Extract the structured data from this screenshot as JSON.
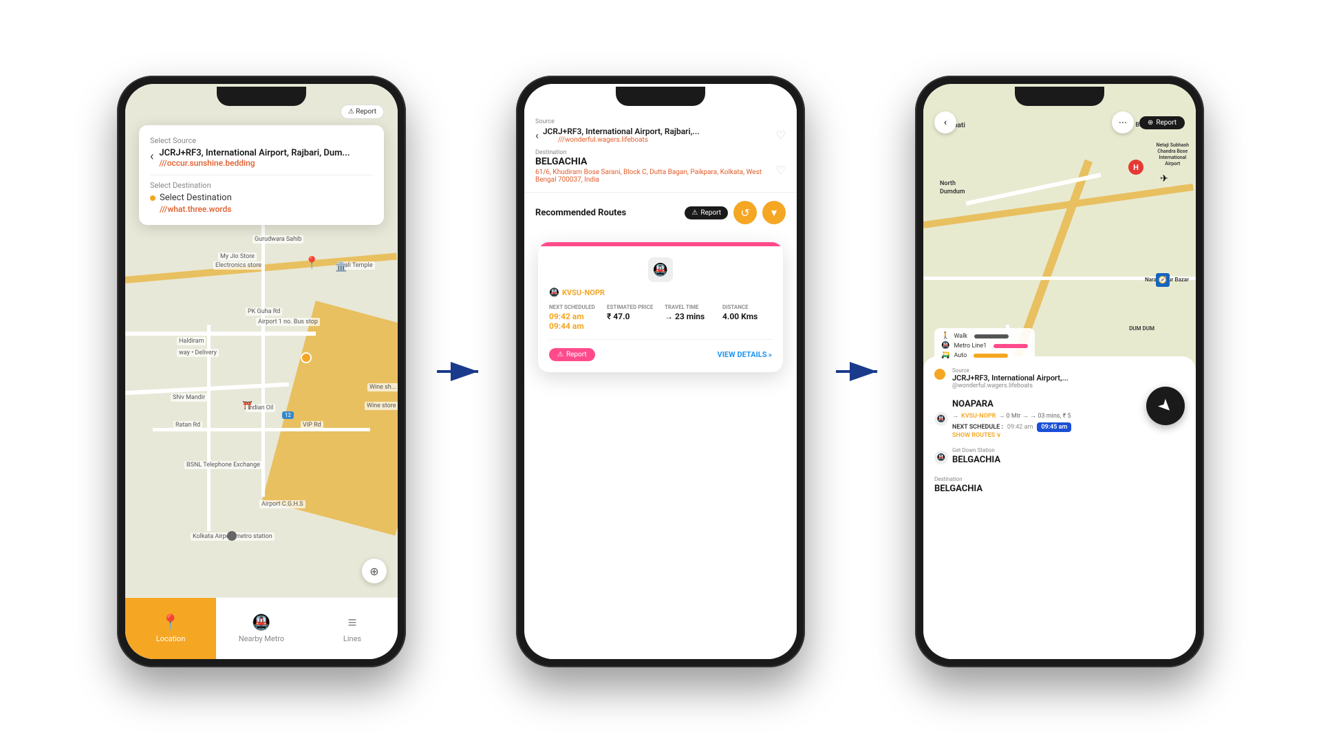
{
  "scene": {
    "arrows": [
      "→",
      "→"
    ]
  },
  "phone1": {
    "search_card": {
      "label_source": "Select Source",
      "source_name": "JCRJ+RF3, International Airport, Rajbari, Dum...",
      "source_w3w": "///occur.sunshine.bedding",
      "label_dest": "Select Destination",
      "dest_name": "Select Destination",
      "dest_w3w": "///what.three.words"
    },
    "report_btn": "Report",
    "map_labels": [
      {
        "text": "Gurudwara Sahib",
        "top": "220",
        "left": "200"
      },
      {
        "text": "My Jio Store",
        "top": "258",
        "left": "152"
      },
      {
        "text": "Electronics store",
        "top": "272",
        "left": "145"
      },
      {
        "text": "Kali Temple",
        "top": "268",
        "left": "340"
      },
      {
        "text": "Airport 1 no. Bus stop",
        "top": "348",
        "left": "210"
      },
      {
        "text": "Haldiram",
        "top": "370",
        "left": "90"
      },
      {
        "text": "way • Delivery",
        "top": "396",
        "left": "90"
      },
      {
        "text": "PK Guha Rd",
        "top": "330",
        "left": "195"
      },
      {
        "text": "Shiv Mandir",
        "top": "456",
        "left": "80"
      },
      {
        "text": "Indian Oil",
        "top": "475",
        "left": "195"
      },
      {
        "text": "Ratan Rd",
        "top": "505",
        "left": "90"
      },
      {
        "text": "VIP Rd",
        "top": "502",
        "left": "272"
      },
      {
        "text": "Wine sh...",
        "top": "447",
        "left": "382"
      },
      {
        "text": "Wine store",
        "top": "479",
        "left": "375"
      },
      {
        "text": "BSNL Telephone Exchange",
        "top": "560",
        "left": "100"
      },
      {
        "text": "Airport C.G.H.S",
        "top": "618",
        "left": "218"
      },
      {
        "text": "Kolkata Airport metro station",
        "top": "664",
        "left": "115"
      }
    ],
    "tabs": [
      {
        "icon": "📍",
        "label": "Location",
        "active": true
      },
      {
        "icon": "🚇",
        "label": "Nearby Metro",
        "active": false
      },
      {
        "icon": "≡",
        "label": "Lines",
        "active": false
      }
    ]
  },
  "phone2": {
    "header": {
      "source_label": "Source",
      "source_name": "JCRJ+RF3, International Airport, Rajbari,...",
      "source_w3w": "///wonderful.wagers.lifeboats",
      "dest_label": "Destination",
      "dest_name": "BELGACHIA",
      "dest_addr": "61/6, Khudiram Bose Sarani, Block C, Dutta Bagan, Paikpara, Kolkata, West Bengal 700037, India"
    },
    "recommended_title": "Recommended Routes",
    "report_label": "Report",
    "route_card": {
      "route_id": "KVSU-NOPR",
      "next_scheduled_label": "NEXT SCHEDULED",
      "next_scheduled_times": "09:42 am\n09:44 am",
      "estimated_price_label": "ESTIMATED PRICE",
      "estimated_price": "₹ 47.0",
      "travel_time_label": "TRAVEL TIME",
      "travel_time": "→ 23 mins",
      "distance_label": "DISTANCE",
      "distance": "4.00 Kms",
      "report_btn": "Report",
      "view_details": "VIEW DETAILS"
    }
  },
  "phone3": {
    "top_bar": {
      "back_icon": "‹",
      "report_label": "Report"
    },
    "map_labels": {
      "panihati": "Panihati",
      "north_dumdum": "North\nDumdum",
      "birati": "BIRATI",
      "narayanpur_bazar": "Narayanpur Bazar",
      "dum_dum": "DUM DUM",
      "netaji": "Netaji Subhash\nChandra Bose\nInternational\nAirport"
    },
    "legend": [
      {
        "label": "Walk",
        "color": "#555"
      },
      {
        "label": "Metro Line1",
        "color": "#ff4b8b"
      },
      {
        "label": "Auto",
        "color": "#f5a623"
      }
    ],
    "panel": {
      "source_label": "Source",
      "source_name": "JCRJ+RF3, International Airport,...",
      "source_w3w": "@wonderful.wagers.lifeboats",
      "stop1": {
        "stop_label": "",
        "stop_name": "NOAPARA",
        "detail": "→ KVSU-NOPR → 0 Mtr → → 03 mins, ₹ 5",
        "next_schedule_label": "NEXT SCHEDULE :",
        "time1": "09:42 am",
        "time2": "09:45 am",
        "show_routes": "SHOW ROUTES ∨"
      },
      "stop2": {
        "get_down_label": "Get Down Station",
        "stop_name": "BELGACHIA"
      },
      "dest": {
        "dest_label": "Destination",
        "dest_name": "BELGACHIA"
      }
    }
  }
}
